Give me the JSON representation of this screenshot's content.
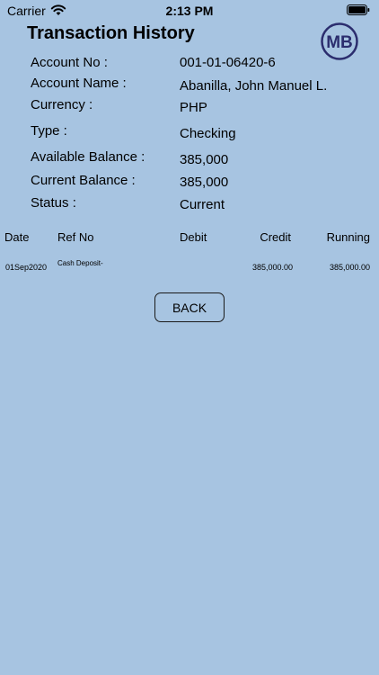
{
  "status_bar": {
    "carrier": "Carrier",
    "time": "2:13 PM"
  },
  "header": {
    "title": "Transaction History",
    "logo_text": "MB"
  },
  "account": {
    "number_label": "Account No :",
    "number_value": "001-01-06420-6",
    "name_label": "Account Name :",
    "name_value": "Abanilla, John Manuel L.",
    "currency_label": "Currency :",
    "currency_value": "PHP",
    "type_label": "Type :",
    "type_value": "Checking",
    "available_label": "Available Balance :",
    "available_value": "385,000",
    "current_label": "Current Balance :",
    "current_value": "385,000",
    "status_label": "Status :",
    "status_value": "Current"
  },
  "transactions": {
    "headers": {
      "date": "Date",
      "ref": "Ref No",
      "debit": "Debit",
      "credit": "Credit",
      "running": "Running"
    },
    "rows": [
      {
        "date": "01Sep2020",
        "ref": "Cash Deposit-",
        "debit": "",
        "credit": "385,000.00",
        "running": "385,000.00"
      }
    ]
  },
  "actions": {
    "back_label": "BACK"
  },
  "colors": {
    "background": "#a7c4e1",
    "logo_brand": "#2b2d6e"
  }
}
